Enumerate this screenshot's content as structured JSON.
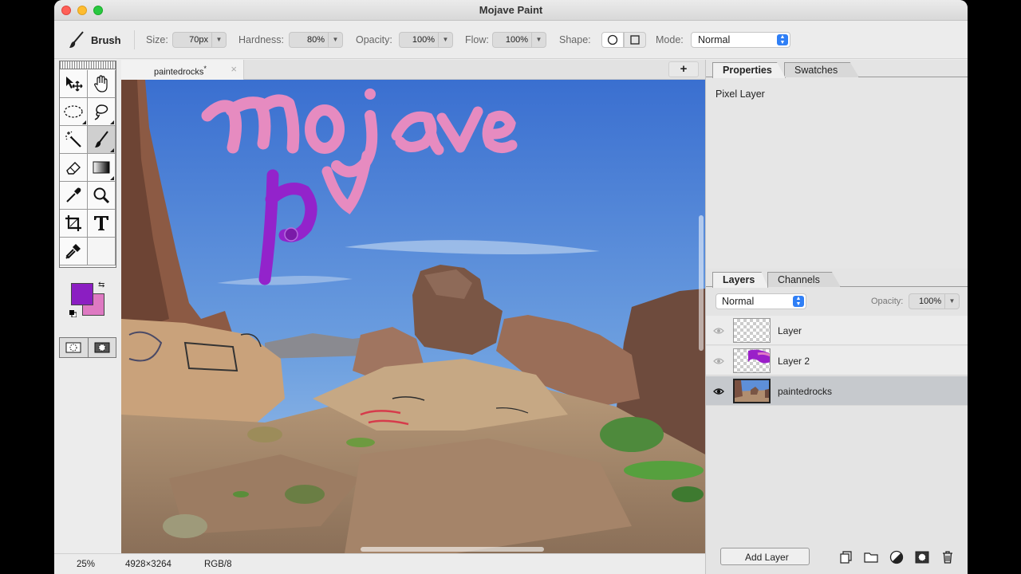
{
  "window": {
    "title": "Mojave Paint"
  },
  "options": {
    "tool_name": "Brush",
    "size_label": "Size:",
    "size_value": "70px",
    "hardness_label": "Hardness:",
    "hardness_value": "80%",
    "opacity_label": "Opacity:",
    "opacity_value": "100%",
    "flow_label": "Flow:",
    "flow_value": "100%",
    "shape_label": "Shape:",
    "mode_label": "Mode:",
    "mode_value": "Normal"
  },
  "colors": {
    "foreground": "#8b1ec2",
    "background": "#de79c2"
  },
  "document": {
    "tab_name": "paintedrocks",
    "tab_modified": "*",
    "add_tab": "+",
    "painted_text_1": "Mojave",
    "painted_text_2": "pv"
  },
  "status": {
    "zoom": "25%",
    "dimensions": "4928×3264",
    "mode": "RGB/8"
  },
  "properties_panel": {
    "tabs": [
      "Properties",
      "Swatches"
    ],
    "active_tab": "Properties",
    "content": "Pixel Layer"
  },
  "layers_panel": {
    "tabs": [
      "Layers",
      "Channels"
    ],
    "active_tab": "Layers",
    "blend_mode": "Normal",
    "opacity_label": "Opacity:",
    "opacity_value": "100%",
    "layers": [
      {
        "name": "Layer",
        "selected": false
      },
      {
        "name": "Layer 2",
        "selected": false
      },
      {
        "name": "paintedrocks",
        "selected": true
      }
    ],
    "add_layer_label": "Add Layer"
  },
  "tools": [
    "move-tool",
    "hand-tool",
    "marquee-tool",
    "lasso-tool",
    "magic-wand-tool",
    "brush-tool",
    "eraser-tool",
    "gradient-tool",
    "eyedropper-tool",
    "zoom-tool",
    "crop-tool",
    "type-tool",
    "clone-stamp-tool"
  ]
}
